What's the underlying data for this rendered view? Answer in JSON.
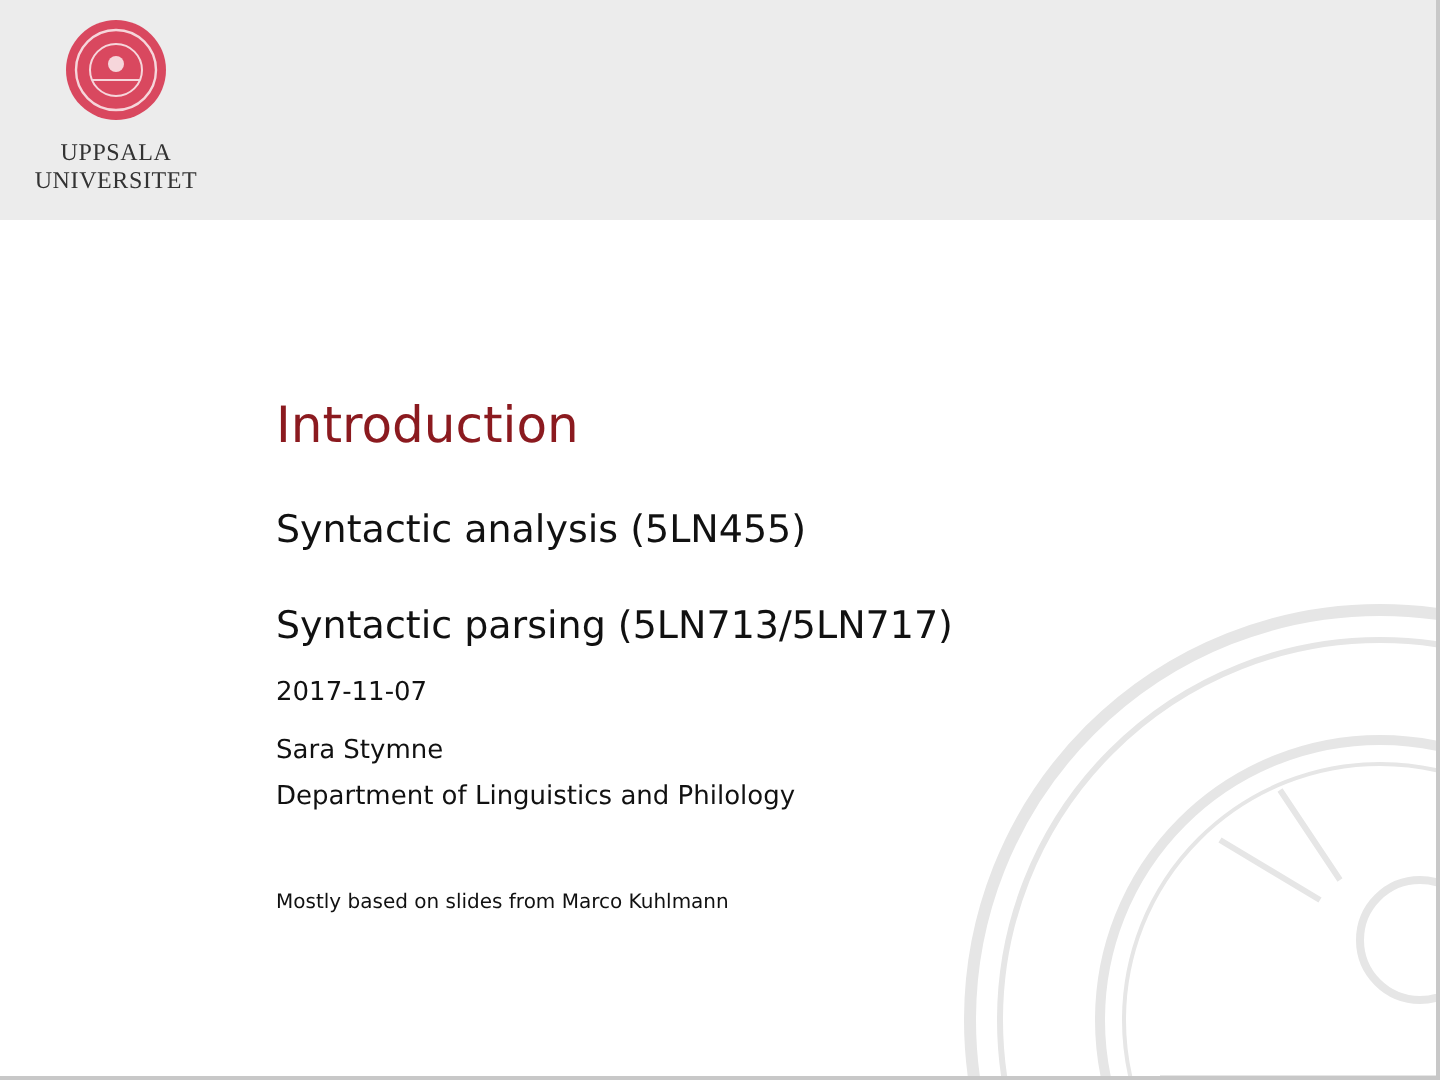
{
  "header": {
    "logo_lines": [
      "UPPSALA",
      "UNIVERSITET"
    ]
  },
  "slide": {
    "title": "Introduction",
    "subtitles": [
      "Syntactic analysis (5LN455)",
      "Syntactic parsing (5LN713/5LN717)"
    ],
    "date": "2017-11-07",
    "author": "Sara Stymne",
    "department": "Department of Linguistics and Philology",
    "note": "Mostly based on slides from Marco Kuhlmann"
  }
}
